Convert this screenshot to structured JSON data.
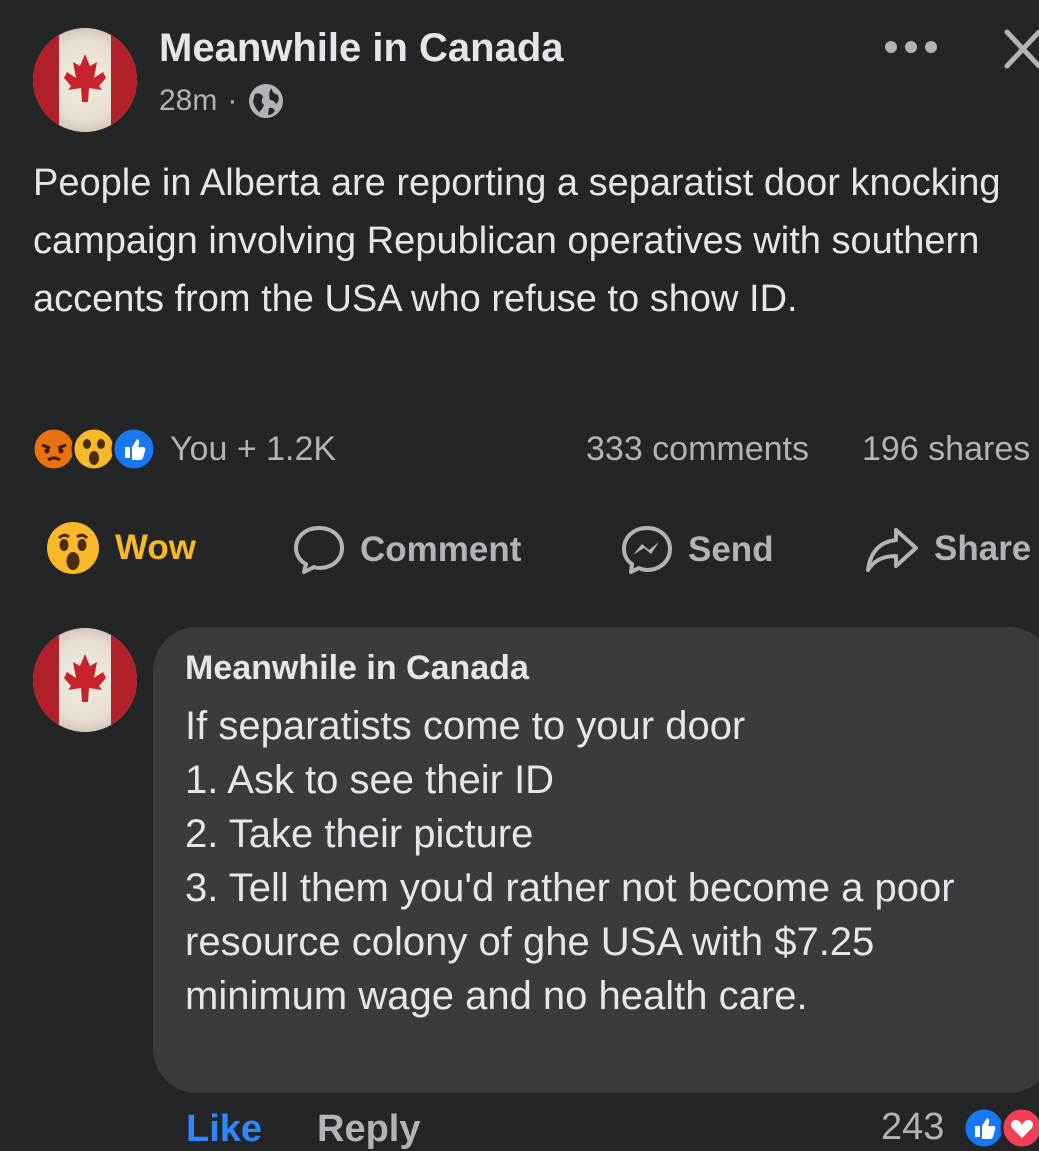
{
  "post": {
    "page_name": "Meanwhile in Canada",
    "time": "28m",
    "separator": "·",
    "audience_icon": "globe-icon",
    "text": "People in Alberta are reporting a separatist door knocking campaign involving Republican operatives with southern accents from the USA who refuse to show ID.",
    "reactions": [
      "angry",
      "wow",
      "like"
    ],
    "reaction_summary": "You + 1.2K",
    "comments_count": "333 comments",
    "shares_count": "196 shares"
  },
  "actions": {
    "wow_label": "Wow",
    "comment_label": "Comment",
    "send_label": "Send",
    "share_label": "Share"
  },
  "comment": {
    "author": "Meanwhile in Canada",
    "text": "If separatists come to your door\n1. Ask to see their ID\n2. Take their picture\n3. Tell them you'd rather not become a poor resource colony of ghe USA with $7.25 minimum wage and no health care.",
    "like_label": "Like",
    "reply_label": "Reply",
    "reaction_count": "243",
    "reactions": [
      "like",
      "love"
    ]
  },
  "colors": {
    "background": "#242526",
    "bubble": "#3a3b3c",
    "primary_text": "#e4e6eb",
    "secondary_text": "#b0b3b8",
    "link_blue": "#2d88ff",
    "wow_yellow": "#f7b928"
  }
}
